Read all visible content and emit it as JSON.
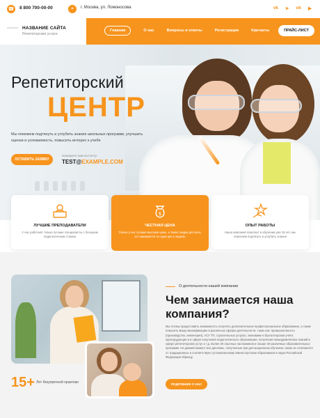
{
  "topbar": {
    "phone": "8 800 700-00-00",
    "address": "г. Москва, ул. Ломоносова",
    "socials": [
      "vk",
      "tg",
      "ok",
      "yt"
    ]
  },
  "header": {
    "site_name": "НАЗВАНИЕ САЙТА",
    "site_subtitle": "Репетиторские услуги",
    "nav": [
      "Главная",
      "О нас",
      "Вопросы и ответы",
      "Регистрация",
      "Контакты"
    ],
    "price_button": "ПРАЙС-ЛИСТ"
  },
  "hero": {
    "title_line1": "Репетиторский",
    "title_line2": "ЦЕНТР",
    "description": "Мы поможем подтянуть и углубить знания школьных программ, улучшить оценки и успеваемость, повысить интерес к учебе",
    "cta": "ОСТАВИТЬ ЗАЯВКУ",
    "mail_label": "Напишите нам на почту:",
    "mail_user": "TEST@",
    "mail_domain": "EXAMPLE.COM"
  },
  "cards": [
    {
      "icon": "teacher-icon",
      "title": "ЛУЧШИЕ ПРЕПОДАВАТЕЛИ",
      "text": "У нас работают только лучшие специалисты с большим педагогическим стажем"
    },
    {
      "icon": "money-icon",
      "title": "ЧЕСТНАЯ ЦЕНА",
      "text": "Только у нас лучшие высокие цены, а также скидки для всех, кто занимается не одни раз в неделю"
    },
    {
      "icon": "star-hand-icon",
      "title": "ОПЫТ РАБОТЫ",
      "text": "Наша компания помогает в обучении уже 15 лет, мы помогаем подтянуть и углубить знания"
    }
  ],
  "about": {
    "label": "О деятельности нашей компании",
    "title": "Чем занимается наша компания?",
    "text": "Мы готовы предоставить возможность получить дополнительное профессиональное образование, а также повысить Вашу квалификацию в различных сферах деятельности, таких как: промышленность (производство, инженерия), АСУ ТП, строительных услугах, экономике и бухгалтерском учете; юриспруденции и в сфере получения педагогического образования, получения неакадемических знаний в сфере репетиторских услуг и т.д. Более 30 опытных наставников и свыше 40 различных образовательных программ. Не давний момент все дипломы, полученные при дистанционном обучении, никак не отличаются от традиционных и соответствуют установленному Министерством образования и науки Российской Федерации образцу.",
    "button": "ПОДРОБНЕЕ О НАС",
    "years": "15+",
    "years_label": "Лет безупречной практики"
  },
  "colors": {
    "accent": "#f7941d",
    "text": "#1d1d1d",
    "section_bg": "#f3f3f3"
  }
}
